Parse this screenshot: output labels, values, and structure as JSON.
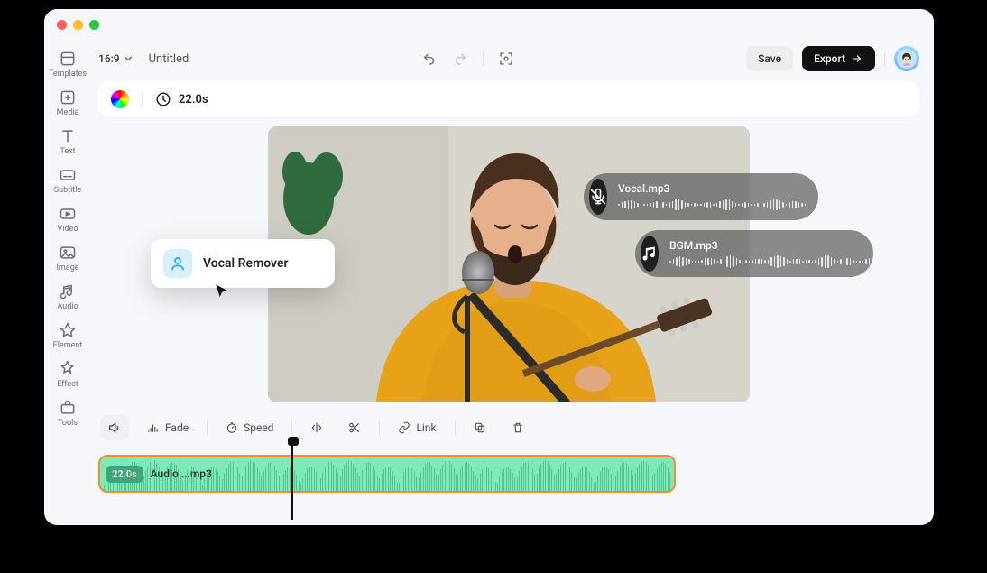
{
  "window": {
    "aspect": "16:9",
    "title": "Untitled"
  },
  "actions": {
    "save": "Save",
    "export": "Export"
  },
  "info": {
    "time": "22.0s"
  },
  "sidebar": [
    {
      "icon": "templates",
      "label": "Templates"
    },
    {
      "icon": "media",
      "label": "Media"
    },
    {
      "icon": "text",
      "label": "Text"
    },
    {
      "icon": "subtitle",
      "label": "Subtitle"
    },
    {
      "icon": "video",
      "label": "Video"
    },
    {
      "icon": "image",
      "label": "Image"
    },
    {
      "icon": "audio",
      "label": "Audio"
    },
    {
      "icon": "element",
      "label": "Element"
    },
    {
      "icon": "effect",
      "label": "Effect"
    },
    {
      "icon": "tools",
      "label": "Tools"
    }
  ],
  "popover": {
    "label": "Vocal Remover"
  },
  "chips": [
    {
      "kind": "mic-off",
      "name": "Vocal.mp3"
    },
    {
      "kind": "music",
      "name": "BGM.mp3"
    }
  ],
  "toolbar": {
    "fade": "Fade",
    "speed": "Speed",
    "link": "Link"
  },
  "clip": {
    "badge": "22.0s",
    "name": "Audio ...mp3"
  }
}
